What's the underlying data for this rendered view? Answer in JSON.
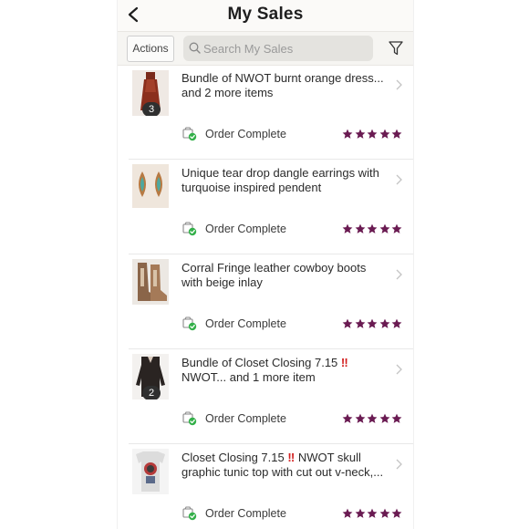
{
  "header": {
    "title": "My Sales",
    "back_icon": "chevron-left-icon"
  },
  "toolbar": {
    "actions_label": "Actions",
    "search_placeholder": "Search My Sales",
    "search_icon": "search-icon",
    "filter_icon": "funnel-icon"
  },
  "colors": {
    "star": "#6a1b52",
    "status_check": "#34b04a",
    "badge": "#2f2f2f",
    "bang": "#d21f1f"
  },
  "sales": [
    {
      "title_line1": "Bundle of NWOT burnt orange dress...",
      "title_line2": "and 2 more items",
      "title_line1_parts": null,
      "thumb_count": "3",
      "status": "Order Complete",
      "rating": 5,
      "thumb": "orange-dress"
    },
    {
      "title_line1": "Unique tear drop dangle earrings with",
      "title_line2": "turquoise inspired pendent",
      "title_line1_parts": null,
      "thumb_count": "",
      "status": "Order Complete",
      "rating": 5,
      "thumb": "earrings"
    },
    {
      "title_line1": "Corral Fringe leather cowboy boots",
      "title_line2": "with beige inlay",
      "title_line1_parts": null,
      "thumb_count": "",
      "status": "Order Complete",
      "rating": 5,
      "thumb": "boots"
    },
    {
      "title_line1": "Bundle of Closet Closing 7.15 ‼️",
      "title_line1_parts": [
        "Bundle of Closet Closing 7.15 ",
        "‼"
      ],
      "title_line2": "NWOT... and 1 more item",
      "thumb_count": "2",
      "status": "Order Complete",
      "rating": 5,
      "thumb": "black-top"
    },
    {
      "title_line1": "Closet Closing 7.15 ‼️ NWOT skull",
      "title_line1_parts": [
        "Closet Closing 7.15 ",
        "‼",
        " NWOT skull"
      ],
      "title_line2": "graphic tunic top with cut out v-neck,...",
      "thumb_count": "",
      "status": "Order Complete",
      "rating": 5,
      "thumb": "skull-tunic"
    }
  ]
}
